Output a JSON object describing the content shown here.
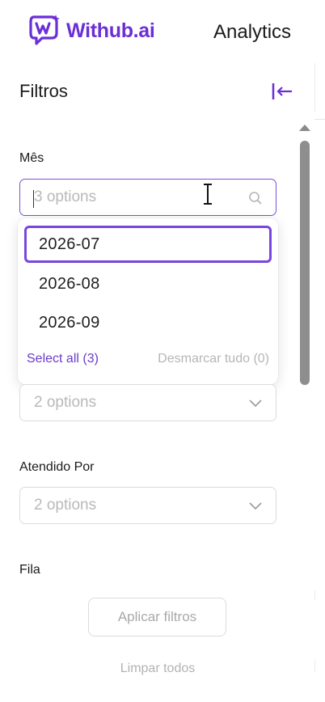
{
  "header": {
    "brand": "Withub.ai",
    "title": "Analytics"
  },
  "sidebar": {
    "title": "Filtros",
    "filters": [
      {
        "label": "Mês",
        "placeholder": "3 options",
        "state": "open",
        "options": [
          "2026-07",
          "2026-08",
          "2026-09"
        ],
        "focused_option": "2026-07",
        "select_all": "Select all (3)",
        "deselect_all": "Desmarcar tudo (0)"
      },
      {
        "label": "",
        "placeholder": "2 options"
      },
      {
        "label": "Atendido Por",
        "placeholder": "2 options"
      },
      {
        "label": "Fila"
      }
    ],
    "apply_button": "Aplicar filtros",
    "clear_link": "Limpar todos"
  },
  "colors": {
    "brand": "#6b2fd6",
    "accent": "#7a45dd",
    "placeholder": "#b9b9b9"
  },
  "icons": [
    "withub-logo-icon",
    "collapse-sidebar-icon",
    "search-icon",
    "chevron-down-icon",
    "text-cursor-icon",
    "scroll-up-arrow"
  ]
}
